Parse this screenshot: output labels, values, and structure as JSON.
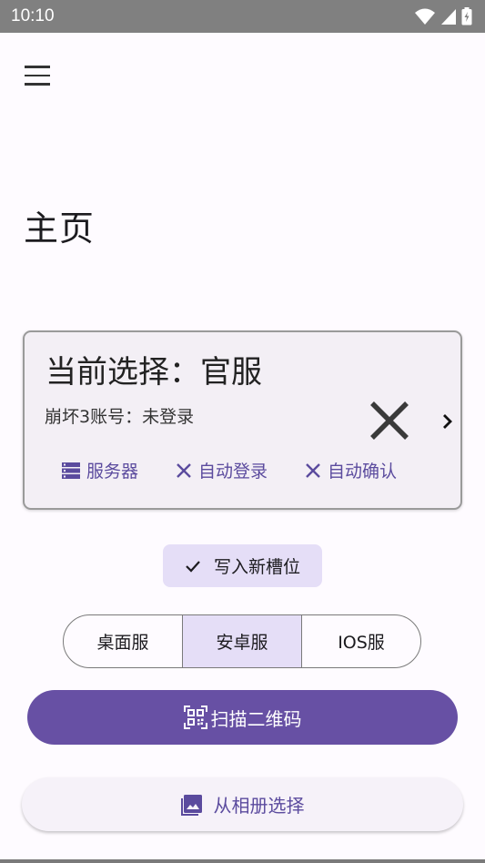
{
  "status_bar": {
    "time": "10:10",
    "icons": [
      "wifi-icon",
      "signal-icon",
      "battery-icon"
    ]
  },
  "header": {
    "menu_icon": "hamburger-menu-icon"
  },
  "page": {
    "title": "主页"
  },
  "card": {
    "selection": "当前选择：官服",
    "account": "崩坏3账号：未登录",
    "options": [
      {
        "icon": "server-icon",
        "label": "服务器"
      },
      {
        "icon": "close-icon",
        "label": "自动登录"
      },
      {
        "icon": "close-icon",
        "label": "自动确认"
      }
    ]
  },
  "chip": {
    "label": "写入新槽位",
    "icon": "check-icon"
  },
  "segments": {
    "items": [
      "桌面服",
      "安卓服",
      "IOS服"
    ],
    "selected": "安卓服"
  },
  "scan_button": {
    "label": "扫描二维码",
    "icon": "qr-scan-icon"
  },
  "album_button": {
    "label": "从相册选择",
    "icon": "image-icon"
  },
  "colors": {
    "primary": "#6750a4",
    "secondary_container": "#e5def7",
    "accent_text": "#5b4b9e",
    "background": "#fefbff"
  }
}
